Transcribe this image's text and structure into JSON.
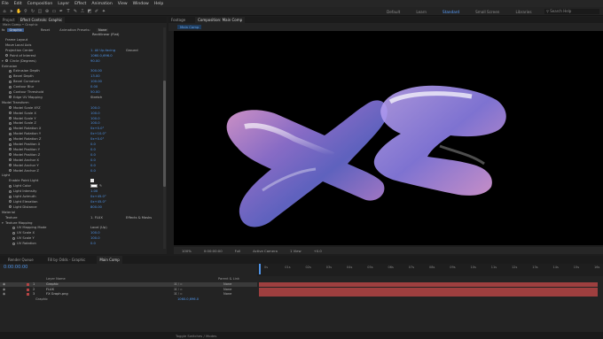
{
  "menu": [
    "File",
    "Edit",
    "Composition",
    "Layer",
    "Effect",
    "Animation",
    "View",
    "Window",
    "Help"
  ],
  "workspaces": [
    {
      "label": "Default",
      "active": false
    },
    {
      "label": "Learn",
      "active": false
    },
    {
      "label": "Standard",
      "active": true
    },
    {
      "label": "Small Screen",
      "active": false
    },
    {
      "label": "Libraries",
      "active": false
    }
  ],
  "search_placeholder": "Search Help",
  "left_panel": {
    "tabs": [
      "Project",
      "Effect Controls: Graphic"
    ],
    "path": "Main Comp • Graphic",
    "fx_name": "Graphic",
    "preset_label": "Animation Presets:",
    "preset_value": "None",
    "renderer": "Rectilinear (Flat)"
  },
  "effect_rows": [
    {
      "label": "Frame Layout",
      "value": "",
      "tw": false,
      "sw": false,
      "indent": 6
    },
    {
      "label": "Move Local Axis",
      "value": "",
      "tw": false,
      "sw": false,
      "indent": 6
    },
    {
      "label": "Projection Center",
      "value": "1. All Up-facing",
      "value2": "Ground",
      "tw": false,
      "sw": false,
      "indent": 6
    },
    {
      "label": "Point of Interest",
      "value": "1060.0,696.0",
      "tw": false,
      "sw": true,
      "indent": 6
    },
    {
      "label": "Circle (Degrees)",
      "value": "90.00",
      "tw": true,
      "sw": true,
      "indent": 6
    },
    {
      "label": "Extrusion",
      "value": "",
      "tw": true,
      "sw": false,
      "indent": 2
    },
    {
      "label": "Extrusion Depth",
      "value": "300.00",
      "tw": false,
      "sw": true,
      "indent": 10
    },
    {
      "label": "Bevel Depth",
      "value": "13.00",
      "tw": false,
      "sw": true,
      "indent": 10
    },
    {
      "label": "Bevel Curvature",
      "value": "100.00",
      "tw": false,
      "sw": true,
      "indent": 10
    },
    {
      "label": "Contour Blur",
      "value": "0.00",
      "tw": false,
      "sw": true,
      "indent": 10
    },
    {
      "label": "Contour Threshold",
      "value": "50.00",
      "tw": false,
      "sw": true,
      "indent": 10
    },
    {
      "label": "Edge UV Mapping",
      "value": "Stretch",
      "tw": false,
      "sw": true,
      "indent": 10,
      "plain": true
    },
    {
      "label": "Model Transform",
      "value": "",
      "tw": true,
      "sw": false,
      "indent": 2
    },
    {
      "label": "Model Scale XYZ",
      "value": "100.0",
      "tw": false,
      "sw": true,
      "indent": 10
    },
    {
      "label": "Model Scale X",
      "value": "100.0",
      "tw": false,
      "sw": true,
      "indent": 10
    },
    {
      "label": "Model Scale Y",
      "value": "100.0",
      "tw": false,
      "sw": true,
      "indent": 10
    },
    {
      "label": "Model Scale Z",
      "value": "100.0",
      "tw": false,
      "sw": true,
      "indent": 10
    },
    {
      "label": "Model Rotation X",
      "value": "0x+0.0°",
      "tw": false,
      "sw": true,
      "indent": 10
    },
    {
      "label": "Model Rotation Y",
      "value": "0x+10.0°",
      "tw": false,
      "sw": true,
      "indent": 10
    },
    {
      "label": "Model Rotation Z",
      "value": "0x+0.0°",
      "tw": false,
      "sw": true,
      "indent": 10
    },
    {
      "label": "Model Position X",
      "value": "0.0",
      "tw": false,
      "sw": true,
      "indent": 10
    },
    {
      "label": "Model Position Y",
      "value": "0.0",
      "tw": false,
      "sw": true,
      "indent": 10
    },
    {
      "label": "Model Position Z",
      "value": "0.0",
      "tw": false,
      "sw": true,
      "indent": 10
    },
    {
      "label": "Model Anchor X",
      "value": "0.0",
      "tw": false,
      "sw": true,
      "indent": 10
    },
    {
      "label": "Model Anchor Y",
      "value": "0.0",
      "tw": false,
      "sw": true,
      "indent": 10
    },
    {
      "label": "Model Anchor Z",
      "value": "0.0",
      "tw": false,
      "sw": true,
      "indent": 10
    },
    {
      "label": "Light",
      "value": "",
      "tw": true,
      "sw": false,
      "indent": 2
    },
    {
      "label": "Enable Point Light",
      "value": "",
      "tw": false,
      "sw": false,
      "indent": 10,
      "checkbox": true
    },
    {
      "label": "Light Color",
      "value": "",
      "tw": false,
      "sw": true,
      "indent": 10,
      "swatch": true
    },
    {
      "label": "Light Intensity",
      "value": "1.00",
      "tw": false,
      "sw": true,
      "indent": 10
    },
    {
      "label": "Light Azimuth",
      "value": "0x+45.0°",
      "tw": false,
      "sw": true,
      "indent": 10
    },
    {
      "label": "Light Elevation",
      "value": "0x+45.0°",
      "tw": false,
      "sw": true,
      "indent": 10
    },
    {
      "label": "Light Distance",
      "value": "800.00",
      "tw": false,
      "sw": true,
      "indent": 10
    },
    {
      "label": "Material",
      "value": "",
      "tw": true,
      "sw": false,
      "indent": 2
    },
    {
      "label": "Texture",
      "value": "1. FLUX",
      "value2": "Effects & Masks",
      "tw": false,
      "sw": false,
      "indent": 6,
      "plain": true
    },
    {
      "label": "Texture Mapping",
      "value": "",
      "tw": true,
      "sw": false,
      "indent": 6
    },
    {
      "label": "UV Mapping Mode",
      "value": "Local (Up)",
      "tw": false,
      "sw": true,
      "indent": 14,
      "plain": true
    },
    {
      "label": "UV Scale X",
      "value": "100.0",
      "tw": false,
      "sw": true,
      "indent": 14
    },
    {
      "label": "UV Scale Y",
      "value": "100.0",
      "tw": false,
      "sw": true,
      "indent": 14
    },
    {
      "label": "UV Rotation",
      "value": "0.0",
      "tw": false,
      "sw": true,
      "indent": 14
    }
  ],
  "composition": {
    "title_tab": "Composition: Main Comp",
    "crumb": "Main Comp",
    "footage_tab": "Footage"
  },
  "viewer_bar": [
    "100%",
    "0:00:00:00",
    "Full",
    "Active Camera",
    "1 View",
    "+0.0"
  ],
  "timeline": {
    "tabs": [
      "Render Queue",
      "Fill by Odds - Graphic",
      "Main Comp"
    ],
    "timecode": "0:00:00:00",
    "col_layer": "Layer Name",
    "col_parent": "Parent & Link",
    "layers": [
      {
        "num": "1",
        "name": "Graphic",
        "parent": "None",
        "color": "#b44444"
      },
      {
        "num": "2",
        "name": "FLUX",
        "parent": "None",
        "color": "#b44444"
      },
      {
        "num": "3",
        "name": "FX Graph.png",
        "parent": "None",
        "color": "#b44444"
      }
    ],
    "sub_row": "Graphic",
    "sub_value": "1060.0,696.0",
    "ruler": [
      "0s",
      "01s",
      "02s",
      "03s",
      "04s",
      "05s",
      "06s",
      "07s",
      "08s",
      "09s",
      "10s",
      "11s",
      "12s",
      "13s",
      "14s",
      "15s",
      "16s"
    ],
    "status": "Toggle Switches / Modes"
  }
}
